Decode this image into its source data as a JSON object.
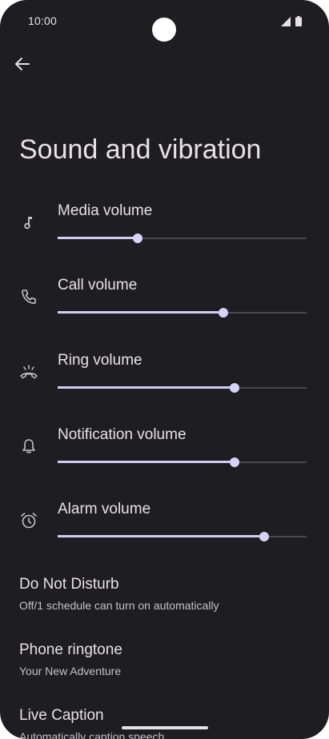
{
  "status_bar": {
    "time": "10:00"
  },
  "header": {
    "title": "Sound and vibration"
  },
  "volumes": [
    {
      "label": "Media volume",
      "icon": "music-note-icon",
      "level": 0.32
    },
    {
      "label": "Call volume",
      "icon": "phone-icon",
      "level": 0.665
    },
    {
      "label": "Ring volume",
      "icon": "ring-icon",
      "level": 0.71
    },
    {
      "label": "Notification volume",
      "icon": "bell-icon",
      "level": 0.71
    },
    {
      "label": "Alarm volume",
      "icon": "alarm-clock-icon",
      "level": 0.83
    }
  ],
  "preferences": [
    {
      "title": "Do Not Disturb",
      "summary": "Off/1 schedule can turn on automatically"
    },
    {
      "title": "Phone ringtone",
      "summary": "Your New Adventure"
    },
    {
      "title": "Live Caption",
      "summary": "Automatically caption speech"
    }
  ],
  "colors": {
    "background": "#1e1e22",
    "text": "#e6e1e8",
    "accent": "#d0cdf5"
  }
}
